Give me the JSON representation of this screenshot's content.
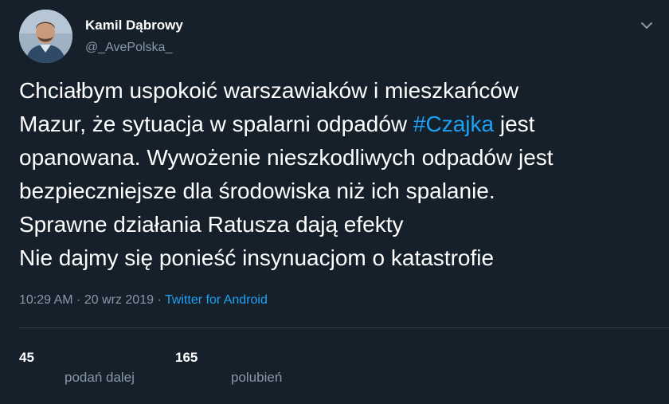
{
  "tweet": {
    "author": {
      "display_name": "Kamil Dąbrowy",
      "handle": "@_AvePolska_",
      "avatar_icon": "profile-photo-avatar"
    },
    "text_lines": [
      {
        "before": "Chciałbym uspokoić warszawiaków i mieszkańców",
        "hashtag": "",
        "after": ""
      },
      {
        "before": "Mazur, że sytuacja w spalarni odpadów ",
        "hashtag": "#Czajka",
        "after": " jest"
      },
      {
        "before": "opanowana. Wywożenie nieszkodliwych odpadów jest",
        "hashtag": "",
        "after": ""
      },
      {
        "before": "bezpieczniejsze dla środowiska niż ich spalanie.",
        "hashtag": "",
        "after": ""
      },
      {
        "before": "Sprawne działania Ratusza dają efekty",
        "hashtag": "",
        "after": ""
      },
      {
        "before": "Nie dajmy się ponieść insynuacjom o katastrofie",
        "hashtag": "",
        "after": ""
      }
    ],
    "meta": {
      "time": "10:29 AM",
      "separator": " · ",
      "date": "20 wrz 2019",
      "separator2": " · ",
      "source": "Twitter for Android"
    },
    "stats": {
      "retweets_count": "45",
      "retweets_label": "podań dalej",
      "likes_count": "165",
      "likes_label": "polubień"
    },
    "menu_icon": "chevron-down-icon"
  },
  "colors": {
    "background": "#15202b",
    "text_primary": "#ffffff",
    "text_secondary": "#8899a6",
    "accent": "#1da1f2",
    "divider": "#38444d"
  }
}
